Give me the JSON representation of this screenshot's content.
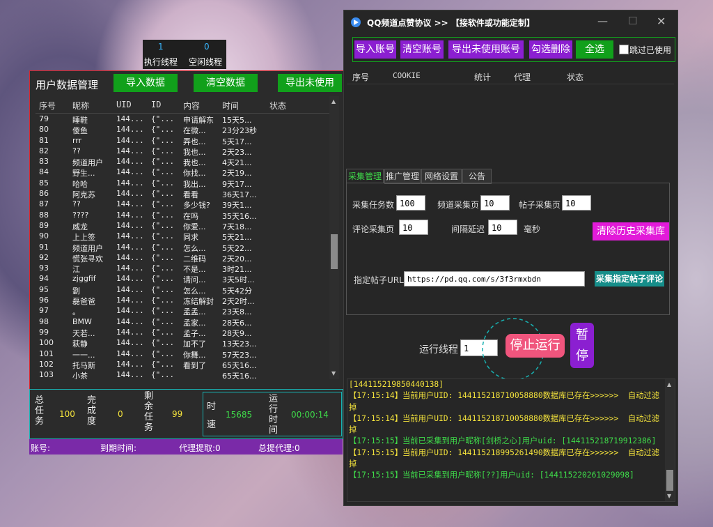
{
  "threads": {
    "exec_value": "1",
    "exec_label": "执行线程",
    "idle_value": "0",
    "idle_label": "空闲线程"
  },
  "left": {
    "title": "用户数据管理",
    "import_label": "导入数据",
    "clear_label": "清空数据",
    "export_label": "导出未使用",
    "columns": [
      "序号",
      "昵称",
      "UID",
      "ID",
      "内容",
      "时间",
      "状态"
    ],
    "rows": [
      [
        "79",
        "睡鞋",
        "144...",
        "{\"...",
        "申请解东",
        "15天5...",
        ""
      ],
      [
        "80",
        "傻鱼",
        "144...",
        "{\"...",
        "在微...",
        "23分23秒",
        ""
      ],
      [
        "81",
        "rrr",
        "144...",
        "{\"...",
        "弄也...",
        "5天17...",
        ""
      ],
      [
        "82",
        "??",
        "144...",
        "{\"...",
        "我也...",
        "2天23...",
        ""
      ],
      [
        "83",
        "频道用户",
        "144...",
        "{\"...",
        "我也...",
        "4天21...",
        ""
      ],
      [
        "84",
        "野生...",
        "144...",
        "{\"...",
        "你找...",
        "2天19...",
        ""
      ],
      [
        "85",
        "哈哈",
        "144...",
        "{\"...",
        "我出...",
        "9天17...",
        ""
      ],
      [
        "86",
        "阿克苏",
        "144...",
        "{\"...",
        "看看",
        "36天17...",
        ""
      ],
      [
        "87",
        "??",
        "144...",
        "{\"...",
        "多少钱?",
        "39天1...",
        ""
      ],
      [
        "88",
        "????",
        "144...",
        "{\"...",
        "在吗",
        "35天16...",
        ""
      ],
      [
        "89",
        "威龙",
        "144...",
        "{\"...",
        "你爱...",
        "7天18...",
        ""
      ],
      [
        "90",
        "上上签",
        "144...",
        "{\"...",
        "同求",
        "5天21...",
        ""
      ],
      [
        "91",
        "频道用户",
        "144...",
        "{\"...",
        "怎么...",
        "5天22...",
        ""
      ],
      [
        "92",
        "慌张寻欢",
        "144...",
        "{\"...",
        "二维码",
        "2天20...",
        ""
      ],
      [
        "93",
        "江",
        "144...",
        "{\"...",
        "不是...",
        "3时21...",
        ""
      ],
      [
        "94",
        "zjggfif",
        "144...",
        "{\"...",
        "请问...",
        "3天5时...",
        ""
      ],
      [
        "95",
        "劉",
        "144...",
        "{\"...",
        "怎么...",
        "5天42分",
        ""
      ],
      [
        "96",
        "磊爸爸",
        "144...",
        "{\"...",
        "冻结解封",
        "2天2时...",
        ""
      ],
      [
        "97",
        "。",
        "144...",
        "{\"...",
        "孟孟...",
        "23天8...",
        ""
      ],
      [
        "98",
        "BMW",
        "144...",
        "{\"...",
        "孟家...",
        "28天6...",
        ""
      ],
      [
        "99",
        "天若...",
        "144...",
        "{\"...",
        "孟子...",
        "28天9...",
        ""
      ],
      [
        "100",
        "萩静",
        "144...",
        "{\"...",
        "加不了",
        "13天23...",
        ""
      ],
      [
        "101",
        "一一...",
        "144...",
        "{\"...",
        "你舞...",
        "57天23...",
        ""
      ],
      [
        "102",
        "托马斯",
        "144...",
        "{\"...",
        "看到了",
        "65天16...",
        ""
      ],
      [
        "103",
        "小茶",
        "144...",
        "{\"...",
        "",
        "65天16...",
        ""
      ]
    ]
  },
  "stats": {
    "total_label": "总任务",
    "total_value": "100",
    "done_label": "完成度",
    "done_value": "0",
    "remain_label": "剩余任务",
    "remain_value": "99",
    "speed_label": "时速",
    "speed_value": "15685",
    "runtime_label": "运行时间",
    "runtime_value": "00:00:14"
  },
  "statusbar": {
    "account": "账号:",
    "expire": "到期时间:",
    "proxy": "代理提取:0",
    "total_proxy": "总提代理:0"
  },
  "right": {
    "title": "QQ频道点赞协议 >> 【接软件或功能定制】",
    "toolbar": {
      "import": "导入账号",
      "clear": "清空账号",
      "export": "导出未使用账号",
      "check_delete": "勾选删除",
      "select_all": "全选",
      "skip_used": "跳过已使用"
    },
    "columns": [
      "序号",
      "COOKIE",
      "统计",
      "代理",
      "状态"
    ],
    "tabs": [
      "采集管理",
      "推广管理",
      "网络设置",
      "公告"
    ],
    "form": {
      "task_count_label": "采集任务数",
      "task_count": "100",
      "channel_pages_label": "频道采集页",
      "channel_pages": "10",
      "post_pages_label": "帖子采集页",
      "post_pages": "10",
      "comment_pages_label": "评论采集页",
      "comment_pages": "10",
      "delay_label": "间隔延迟",
      "delay": "10",
      "delay_unit": "毫秒",
      "clear_history": "清除历史采集库",
      "url_label": "指定帖子URL",
      "url": "https://pd.qq.com/s/3f3rmxbdn",
      "collect_comments": "采集指定帖子评论"
    },
    "run_threads_label": "运行线程",
    "run_threads": "1",
    "stop_label": "停止运行",
    "pause_label": "暂停",
    "log": [
      "[144115219850440138]",
      "【17:15:14】当前用户UID: 144115218710058880数据库已存在>>>>>>  自动过滤掉",
      "【17:15:14】当前用户UID: 144115218710058880数据库已存在>>>>>>  自动过滤掉",
      "【17:15:15】当前已采集到用户昵称[剑桥之心]用户uid: [144115218719912386]",
      "【17:15:15】当前用户UID: 144115218995261490数据库已存在>>>>>>  自动过滤掉",
      "【17:15:15】当前已采集到用户昵称[??]用户uid: [144115220261029098]"
    ]
  },
  "colors": {
    "green": "#11a01b",
    "purple": "#8b1fd1",
    "magenta": "#e21bd9",
    "teal": "#168e8a",
    "stop": "#f0557d",
    "log_yellow": "#f3e23c",
    "log_green": "#3fdc4a"
  }
}
